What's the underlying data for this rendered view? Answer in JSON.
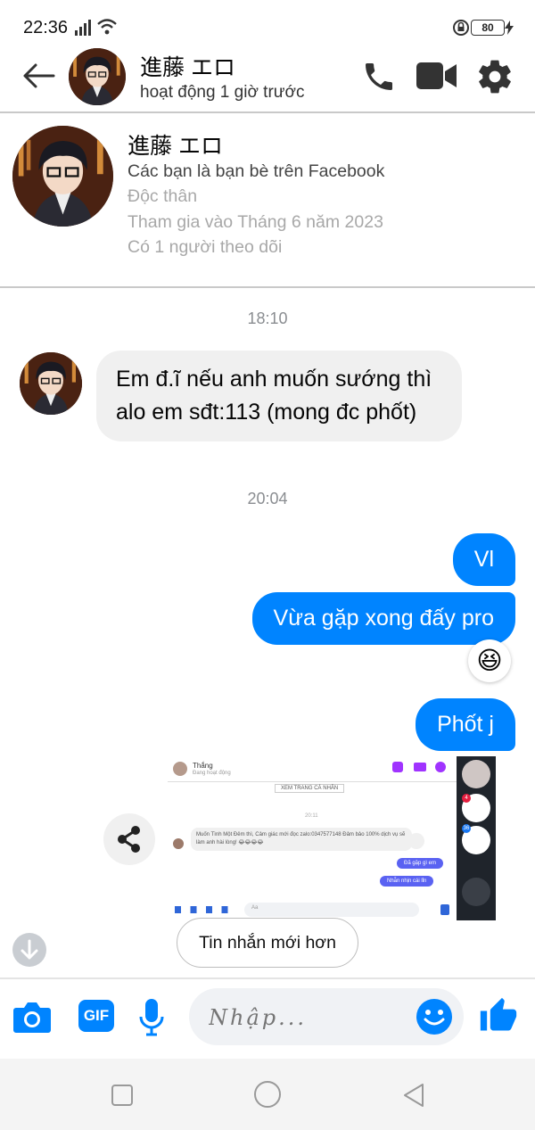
{
  "status_bar": {
    "time": "22:36",
    "battery": "80"
  },
  "header": {
    "name": "進藤 エロ",
    "status": "hoạt động 1 giờ trước"
  },
  "profile": {
    "name": "進藤 エロ",
    "lines": [
      "Các bạn là bạn bè trên Facebook",
      "Độc thân",
      "Tham gia vào Tháng 6 năm 2023",
      "Có 1 người theo dõi"
    ]
  },
  "messages": {
    "time1": "18:10",
    "incoming1": "Em đ.ĩ nếu anh muốn sướng thì alo em sđt:113 (mong đc phốt)",
    "time2": "20:04",
    "out1": "Vl",
    "out2": "Vừa gặp xong đấy pro",
    "reaction": "😆",
    "out3": "Phốt j"
  },
  "screenshot_preview": {
    "contact": "Thắng",
    "contact_status": "Đang hoạt động",
    "profile_link": "XEM TRANG CÁ NHÂN",
    "date": "20:11",
    "incoming": "Muốn Tình Một Đêm thì, Cảm giác mới đọc zalo:0347577148 Đảm bảo 100% dịch vụ sẽ làm anh hài lòng! 😂😂😂😂",
    "out1": "Đã gặp gì em",
    "out2": "Nhẫn nhịn cái lỉn",
    "input_placeholder": "Aa",
    "badge1": "4",
    "badge2": "36"
  },
  "newer_button": "Tin nhắn mới hơn",
  "composer": {
    "placeholder": "Nhập..."
  },
  "colors": {
    "accent": "#0084ff",
    "bubble_in": "#f0f0f0"
  },
  "icons": [
    "back-arrow-icon",
    "phone-icon",
    "video-icon",
    "gear-icon",
    "share-icon",
    "scroll-down-icon",
    "camera-icon",
    "gif-icon",
    "mic-icon",
    "emoji-icon",
    "thumbs-up-icon"
  ]
}
